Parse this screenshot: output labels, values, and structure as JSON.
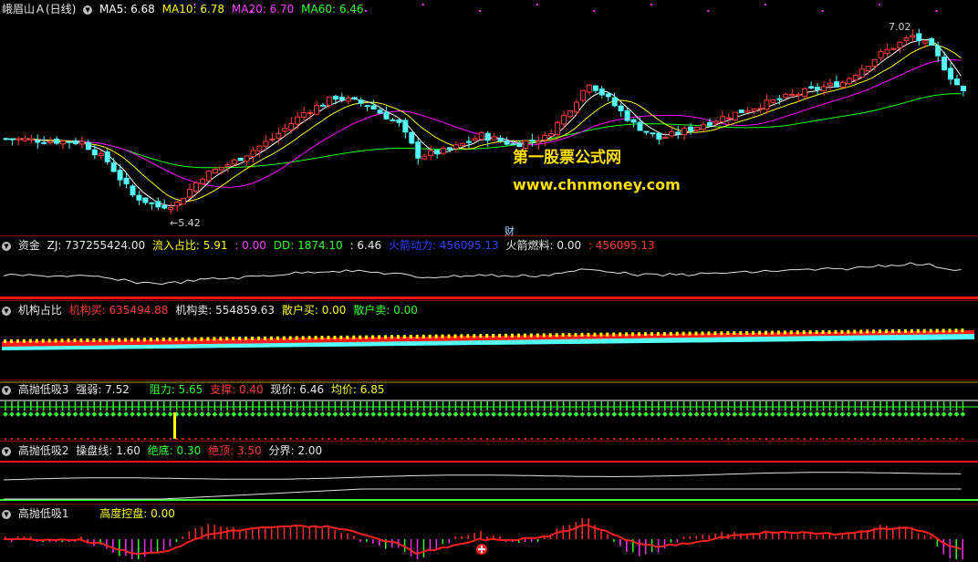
{
  "main": {
    "title": "峨眉山Ａ(日线)",
    "ma5": "MA5: 6.68",
    "ma10": "MA10: 6.78",
    "ma20": "MA20: 6.70",
    "ma60": "MA60: 6.46",
    "high_label": "7.02",
    "low_label": "5.42",
    "cai_label": "财",
    "watermark1": "第一股票公式网",
    "watermark2": "www.chnmoney.com"
  },
  "p1": {
    "name": "资金",
    "zj": "ZJ: 737255424.00",
    "lrzb": "流入占比: 5.91",
    "lrzb2": ": 0.00",
    "dd": "DD: 1874.10",
    "dd2": ": 6.46",
    "hjdl": "火箭动力: 456095.13",
    "hjrl": "火箭燃料: 0.00",
    "hjrl2": ": 456095.13"
  },
  "p2": {
    "name": "机构占比",
    "jgm": "机构买: 635494.88",
    "jgs": "机构卖: 554859.63",
    "shm": "散户买: 0.00",
    "shs": "散户卖: 0.00"
  },
  "p3": {
    "name": "高抛低吸3",
    "qr": "强弱: 7.52",
    "zl": "阻力: 5.65",
    "zc": "支撑: 0.40",
    "xj": "现价: 6.46",
    "jj": "均价: 6.85"
  },
  "p4": {
    "name": "高抛低吸2",
    "cpx": "操盘线: 1.60",
    "jd": "绝底: 0.30",
    "jding": "绝顶: 3.50",
    "fj": "分界: 2.00"
  },
  "p5": {
    "name": "高抛低吸1",
    "gdkp": "高度控盘: 0.00"
  },
  "colors": {
    "up": "#ff3c3c",
    "down": "#54ffff",
    "ma5": "#ffffff",
    "ma10": "#ffff00",
    "ma20": "#ff00ff",
    "ma60": "#00ff00",
    "bg": "#000000",
    "border": "#7a0000"
  }
}
